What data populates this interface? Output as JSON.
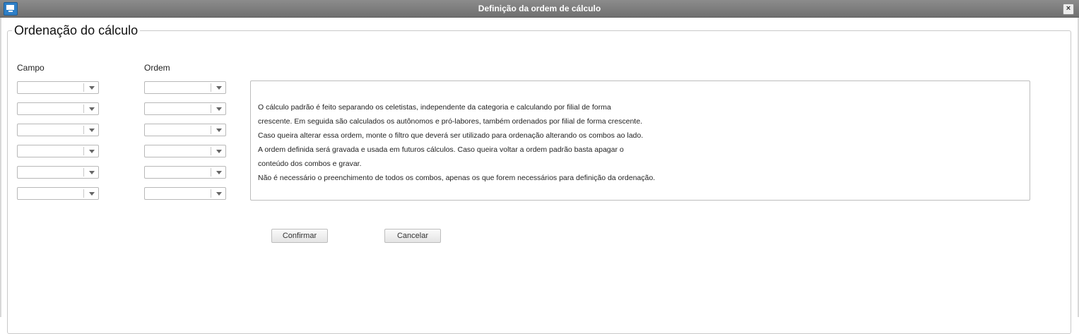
{
  "window": {
    "title": "Definição da ordem de cálculo",
    "close_glyph": "×"
  },
  "group": {
    "legend": "Ordenação do cálculo"
  },
  "columns": {
    "campo_label": "Campo",
    "ordem_label": "Ordem"
  },
  "combos": {
    "campo": [
      "",
      "",
      "",
      "",
      "",
      ""
    ],
    "ordem": [
      "",
      "",
      "",
      "",
      "",
      ""
    ]
  },
  "info": {
    "lines": [
      " O cálculo padrão é feito separando os celetistas, independente da categoria e calculando por filial de forma",
      "crescente. Em seguida são calculados os autônomos e pró-labores, também ordenados por filial de forma crescente.",
      " Caso queira alterar essa ordem, monte o filtro que deverá ser utilizado para ordenação alterando os combos ao lado.",
      " A ordem definida será gravada e usada em futuros cálculos. Caso queira voltar a ordem padrão basta apagar o",
      "conteúdo dos combos e gravar.",
      " Não é necessário o preenchimento de todos os combos, apenas os que forem necessários para definição da ordenação."
    ]
  },
  "buttons": {
    "confirm": "Confirmar",
    "cancel": "Cancelar"
  },
  "icons": {
    "app": "monitor-icon",
    "close": "close-icon",
    "dropdown": "chevron-down-icon"
  }
}
